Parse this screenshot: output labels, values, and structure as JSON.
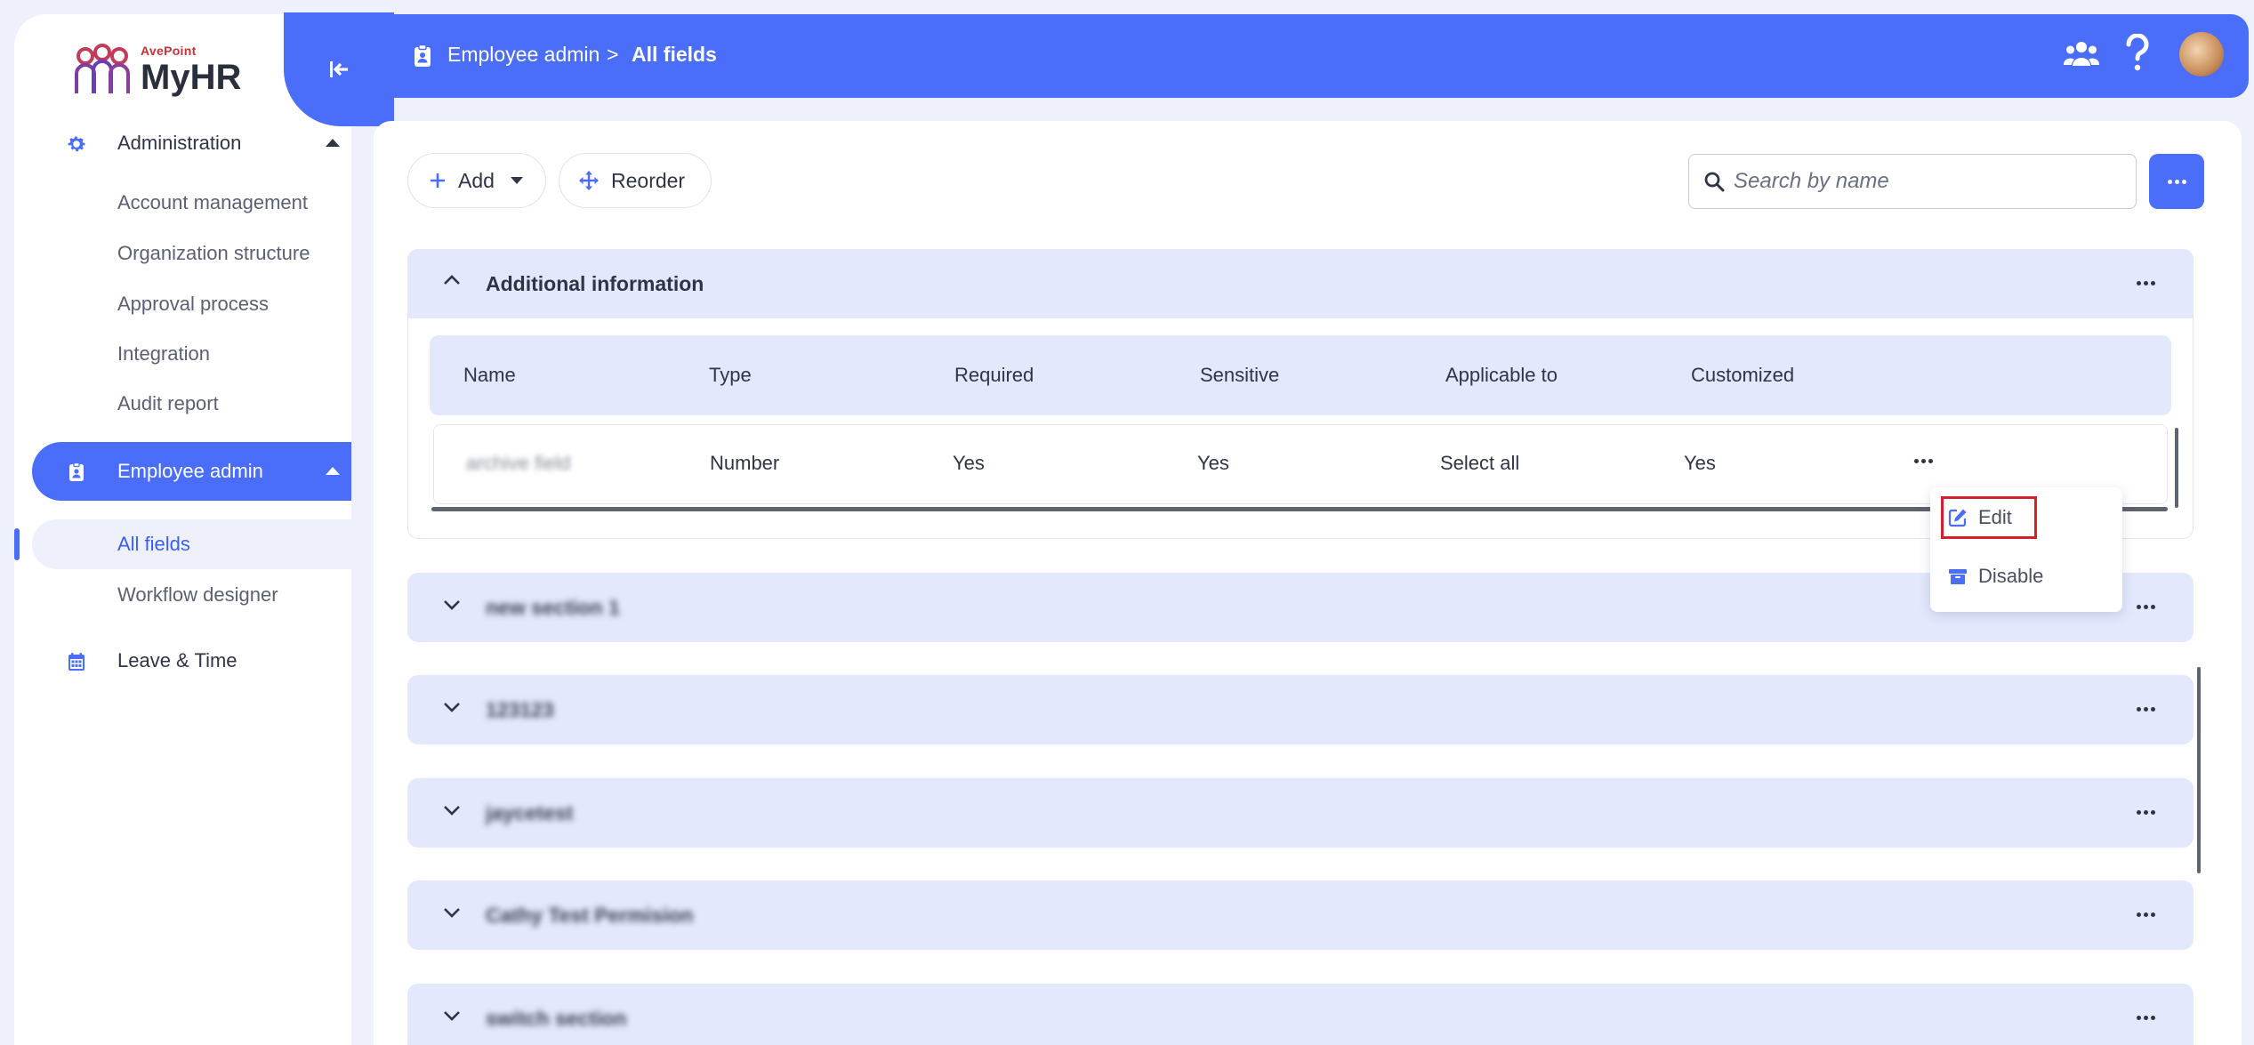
{
  "app": {
    "brand_small": "AvePoint",
    "name": "MyHR"
  },
  "sidebar": {
    "sections": [
      {
        "label": "Administration",
        "items": [
          "Account management",
          "Organization structure",
          "Approval process",
          "Integration",
          "Audit report"
        ]
      },
      {
        "label": "Employee admin",
        "items": [
          "All fields",
          "Workflow designer"
        ]
      },
      {
        "label": "Leave & Time",
        "items": []
      }
    ],
    "selected_item": "All fields"
  },
  "header": {
    "breadcrumb": [
      "Employee admin",
      "All fields"
    ],
    "separator": ">",
    "icons": [
      "people-icon",
      "help-icon",
      "avatar"
    ]
  },
  "toolbar": {
    "add_label": "Add",
    "reorder_label": "Reorder",
    "search_placeholder": "Search by name"
  },
  "sections": [
    {
      "title": "Additional information",
      "expanded": true,
      "columns": [
        "Name",
        "Type",
        "Required",
        "Sensitive",
        "Applicable to",
        "Customized"
      ],
      "rows": [
        {
          "name": "archive field",
          "type": "Number",
          "required": "Yes",
          "sensitive": "Yes",
          "applicable_to": "Select all",
          "customized": "Yes"
        }
      ]
    },
    {
      "title": "new section 1",
      "expanded": false
    },
    {
      "title": "123123",
      "expanded": false
    },
    {
      "title": "jaycetest",
      "expanded": false
    },
    {
      "title": "Cathy Test Permision",
      "expanded": false
    },
    {
      "title": "switch section",
      "expanded": false
    }
  ],
  "context_menu": {
    "items": [
      "Edit",
      "Disable"
    ],
    "highlighted": "Edit"
  },
  "colors": {
    "accent": "#4a6dfa",
    "section_bg": "#e3e8fd",
    "page_bg": "#eef1fb",
    "highlight_border": "#d4202a"
  }
}
